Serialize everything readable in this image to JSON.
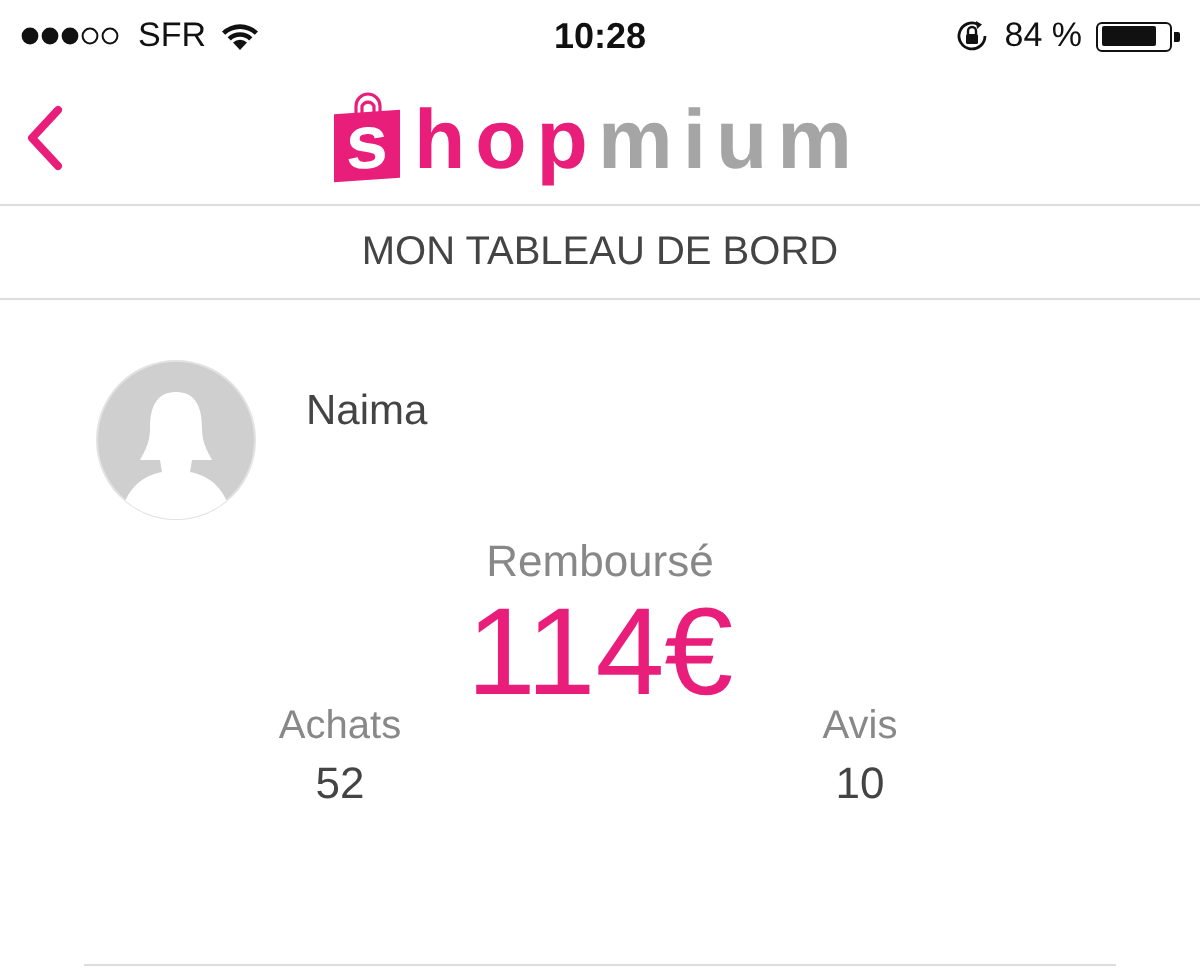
{
  "status_bar": {
    "carrier": "SFR",
    "time": "10:28",
    "battery": "84 %"
  },
  "nav": {
    "logo": {
      "bag_letter": "s",
      "accent": "hop",
      "rest": "mium"
    }
  },
  "title": "MON TABLEAU DE BORD",
  "profile": {
    "name": "Naima"
  },
  "refund": {
    "label": "Remboursé",
    "amount": "114€"
  },
  "stats": [
    {
      "label": "Achats",
      "value": "52"
    },
    {
      "label": "Avis",
      "value": "10"
    }
  ]
}
